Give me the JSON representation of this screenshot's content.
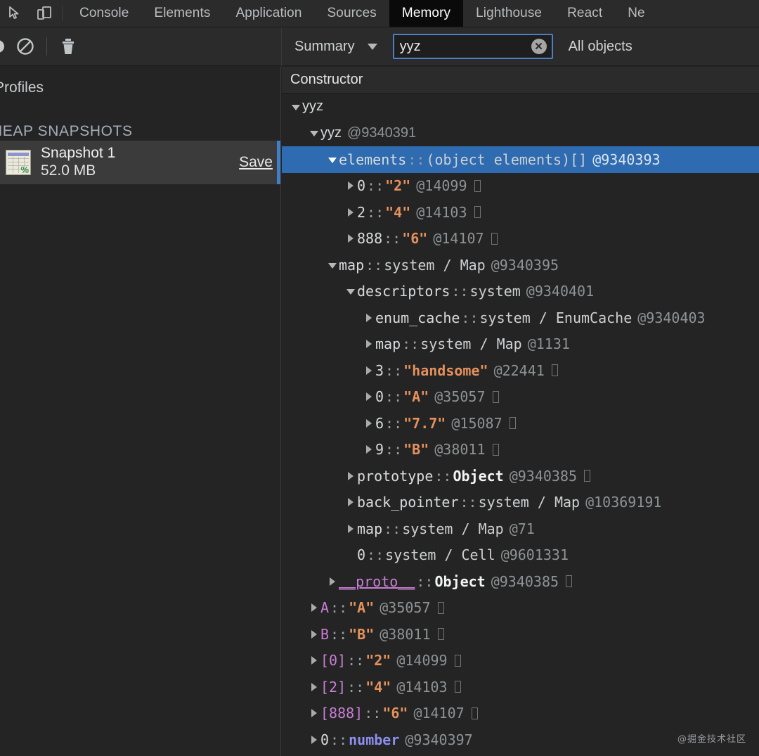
{
  "window": {
    "tabs": [
      {
        "label": "Console",
        "selected": false
      },
      {
        "label": "Elements",
        "selected": false
      },
      {
        "label": "Application",
        "selected": false
      },
      {
        "label": "Sources",
        "selected": false
      },
      {
        "label": "Memory",
        "selected": true
      },
      {
        "label": "Lighthouse",
        "selected": false
      },
      {
        "label": "React",
        "selected": false
      },
      {
        "label": "Ne",
        "selected": false
      }
    ],
    "inspect_icon": "inspect-cursor-icon",
    "device_icon": "device-toolbar-icon"
  },
  "toolbar": {
    "record_icon": "record-circle-icon",
    "clear_icon": "no-entry-icon",
    "trash_icon": "trash-icon",
    "view_select_label": "Summary",
    "search_value": "yyz",
    "search_placeholder": "",
    "clear_search_label": "✕",
    "class_filter_label": "All objects"
  },
  "sidebar": {
    "title": "Profiles",
    "section_label": "HEAP SNAPSHOTS",
    "snapshot": {
      "name": "Snapshot 1",
      "size": "52.0 MB",
      "save_label": "Save",
      "thumb_pct": "%"
    }
  },
  "main": {
    "column_header": "Constructor",
    "watermark": "@掘金技术社区",
    "rows": [
      {
        "indent": 0,
        "tri": "open",
        "name": "yyz",
        "nameStyle": "plain",
        "sep": "",
        "value": "",
        "valueStyle": "",
        "addr": "",
        "box": false,
        "selected": false,
        "mono": false
      },
      {
        "indent": 1,
        "tri": "open",
        "name": "yyz",
        "nameStyle": "plain",
        "sep": "",
        "value": "",
        "valueStyle": "",
        "addr": "@9340391",
        "box": false,
        "selected": false,
        "mono": false
      },
      {
        "indent": 2,
        "tri": "open",
        "name": "elements",
        "nameStyle": "plain",
        "sep": "::",
        "value": "(object elements)[]",
        "valueStyle": "sys",
        "addr": "@9340393",
        "box": false,
        "selected": true,
        "mono": true
      },
      {
        "indent": 3,
        "tri": "closed",
        "name": "0",
        "nameStyle": "plain",
        "sep": "::",
        "value": "\"2\"",
        "valueStyle": "str",
        "addr": "@14099",
        "box": true,
        "selected": false,
        "mono": true
      },
      {
        "indent": 3,
        "tri": "closed",
        "name": "2",
        "nameStyle": "plain",
        "sep": "::",
        "value": "\"4\"",
        "valueStyle": "str",
        "addr": "@14103",
        "box": true,
        "selected": false,
        "mono": true
      },
      {
        "indent": 3,
        "tri": "closed",
        "name": "888",
        "nameStyle": "plain",
        "sep": "::",
        "value": "\"6\"",
        "valueStyle": "str",
        "addr": "@14107",
        "box": true,
        "selected": false,
        "mono": true
      },
      {
        "indent": 2,
        "tri": "open",
        "name": "map",
        "nameStyle": "plain",
        "sep": "::",
        "value": "system / Map",
        "valueStyle": "sys",
        "addr": "@9340395",
        "box": false,
        "selected": false,
        "mono": true
      },
      {
        "indent": 3,
        "tri": "open",
        "name": "descriptors",
        "nameStyle": "plain",
        "sep": "::",
        "value": "system",
        "valueStyle": "sys",
        "addr": "@9340401",
        "box": false,
        "selected": false,
        "mono": true
      },
      {
        "indent": 4,
        "tri": "closed",
        "name": "enum_cache",
        "nameStyle": "plain",
        "sep": "::",
        "value": "system / EnumCache",
        "valueStyle": "sys",
        "addr": "@9340403",
        "box": false,
        "selected": false,
        "mono": true
      },
      {
        "indent": 4,
        "tri": "closed",
        "name": "map",
        "nameStyle": "plain",
        "sep": "::",
        "value": "system / Map",
        "valueStyle": "sys",
        "addr": "@1131",
        "box": false,
        "selected": false,
        "mono": true
      },
      {
        "indent": 4,
        "tri": "closed",
        "name": "3",
        "nameStyle": "plain",
        "sep": "::",
        "value": "\"handsome\"",
        "valueStyle": "str",
        "addr": "@22441",
        "box": true,
        "selected": false,
        "mono": true
      },
      {
        "indent": 4,
        "tri": "closed",
        "name": "0",
        "nameStyle": "plain",
        "sep": "::",
        "value": "\"A\"",
        "valueStyle": "str",
        "addr": "@35057",
        "box": true,
        "selected": false,
        "mono": true
      },
      {
        "indent": 4,
        "tri": "closed",
        "name": "6",
        "nameStyle": "plain",
        "sep": "::",
        "value": "\"7.7\"",
        "valueStyle": "str",
        "addr": "@15087",
        "box": true,
        "selected": false,
        "mono": true
      },
      {
        "indent": 4,
        "tri": "closed",
        "name": "9",
        "nameStyle": "plain",
        "sep": "::",
        "value": "\"B\"",
        "valueStyle": "str",
        "addr": "@38011",
        "box": true,
        "selected": false,
        "mono": true
      },
      {
        "indent": 3,
        "tri": "closed",
        "name": "prototype",
        "nameStyle": "plain",
        "sep": "::",
        "value": "Object",
        "valueStyle": "obj",
        "addr": "@9340385",
        "box": true,
        "selected": false,
        "mono": true
      },
      {
        "indent": 3,
        "tri": "closed",
        "name": "back_pointer",
        "nameStyle": "plain",
        "sep": "::",
        "value": "system / Map",
        "valueStyle": "sys",
        "addr": "@10369191",
        "box": false,
        "selected": false,
        "mono": true
      },
      {
        "indent": 3,
        "tri": "closed",
        "name": "map",
        "nameStyle": "plain",
        "sep": "::",
        "value": "system / Map",
        "valueStyle": "sys",
        "addr": "@71",
        "box": false,
        "selected": false,
        "mono": true
      },
      {
        "indent": 3,
        "tri": "none",
        "name": "0",
        "nameStyle": "plain",
        "sep": "::",
        "value": "system / Cell",
        "valueStyle": "sys",
        "addr": "@9601331",
        "box": false,
        "selected": false,
        "mono": true
      },
      {
        "indent": 2,
        "tri": "closed",
        "name": "__proto__",
        "nameStyle": "purple-u",
        "sep": "::",
        "value": "Object",
        "valueStyle": "obj",
        "addr": "@9340385",
        "box": true,
        "selected": false,
        "mono": true
      },
      {
        "indent": 1,
        "tri": "closed",
        "name": "A",
        "nameStyle": "purple",
        "sep": "::",
        "value": "\"A\"",
        "valueStyle": "str",
        "addr": "@35057",
        "box": true,
        "selected": false,
        "mono": true
      },
      {
        "indent": 1,
        "tri": "closed",
        "name": "B",
        "nameStyle": "purple",
        "sep": "::",
        "value": "\"B\"",
        "valueStyle": "str",
        "addr": "@38011",
        "box": true,
        "selected": false,
        "mono": true
      },
      {
        "indent": 1,
        "tri": "closed",
        "name": "[0]",
        "nameStyle": "purple",
        "sep": "::",
        "value": "\"2\"",
        "valueStyle": "str",
        "addr": "@14099",
        "box": true,
        "selected": false,
        "mono": true
      },
      {
        "indent": 1,
        "tri": "closed",
        "name": "[2]",
        "nameStyle": "purple",
        "sep": "::",
        "value": "\"4\"",
        "valueStyle": "str",
        "addr": "@14103",
        "box": true,
        "selected": false,
        "mono": true
      },
      {
        "indent": 1,
        "tri": "closed",
        "name": "[888]",
        "nameStyle": "purple",
        "sep": "::",
        "value": "\"6\"",
        "valueStyle": "str",
        "addr": "@14107",
        "box": true,
        "selected": false,
        "mono": true
      },
      {
        "indent": 1,
        "tri": "closed",
        "name": "0",
        "nameStyle": "plain",
        "sep": "::",
        "value": "number",
        "valueStyle": "num",
        "addr": "@9340397",
        "box": false,
        "selected": false,
        "mono": true
      }
    ]
  },
  "colors": {
    "accent_selection": "#2f6bb0",
    "string_value": "#e5915c",
    "property_purple": "#c87fd4",
    "number_blue": "#8d8ff0",
    "panel_bg": "#242424",
    "toolbar_bg": "#2b2b2b"
  }
}
